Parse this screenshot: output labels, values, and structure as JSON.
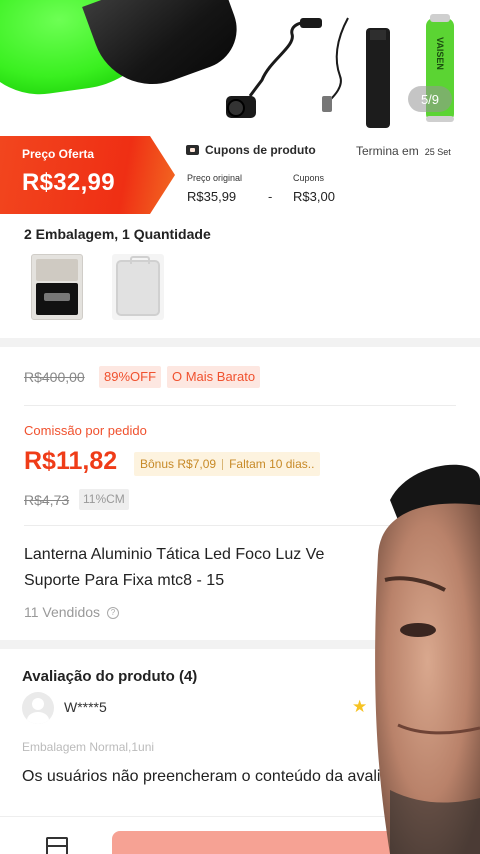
{
  "hero": {
    "image_counter": "5/9",
    "battery_label": "VAISEN"
  },
  "price_banner": {
    "offer_label": "Preço Oferta",
    "offer_price": "R$32,99",
    "coupon_title": "Cupons de produto",
    "ends_label": "Termina em",
    "ends_date": "25 Set",
    "original_label": "Preço original",
    "original_value": "R$35,99",
    "minus": "-",
    "coupons_label": "Cupons",
    "coupons_value": "R$3,00"
  },
  "variants": {
    "title": "2 Embalagem, 1 Quantidade"
  },
  "pricing": {
    "old_price": "R$400,00",
    "discount_tag": "89%OFF",
    "cheapest_tag": "O Mais Barato",
    "commission_label": "Comissão por pedido",
    "commission_value": "R$11,82",
    "bonus_text": "Bônus R$7,09",
    "days_left": "Faltam 10 dias..",
    "commission_old": "R$4,73",
    "commission_pct": "11%CM"
  },
  "product": {
    "name_line1": "Lanterna Aluminio Tática Led Foco Luz Ve",
    "name_line2": "Suporte Para Fixa mtc8 - 15",
    "sold": "11 Vendidos",
    "info_glyph": "?"
  },
  "reviews": {
    "title": "Avaliação do produto (4)",
    "user": "W****5",
    "star": "★",
    "variant": "Embalagem Normal,1uni",
    "text": "Os usuários não preencheram o conteúdo da avaliação."
  },
  "colors": {
    "accent": "#ef3c18",
    "band": "#fde6da",
    "bonus": "#c78a28"
  }
}
